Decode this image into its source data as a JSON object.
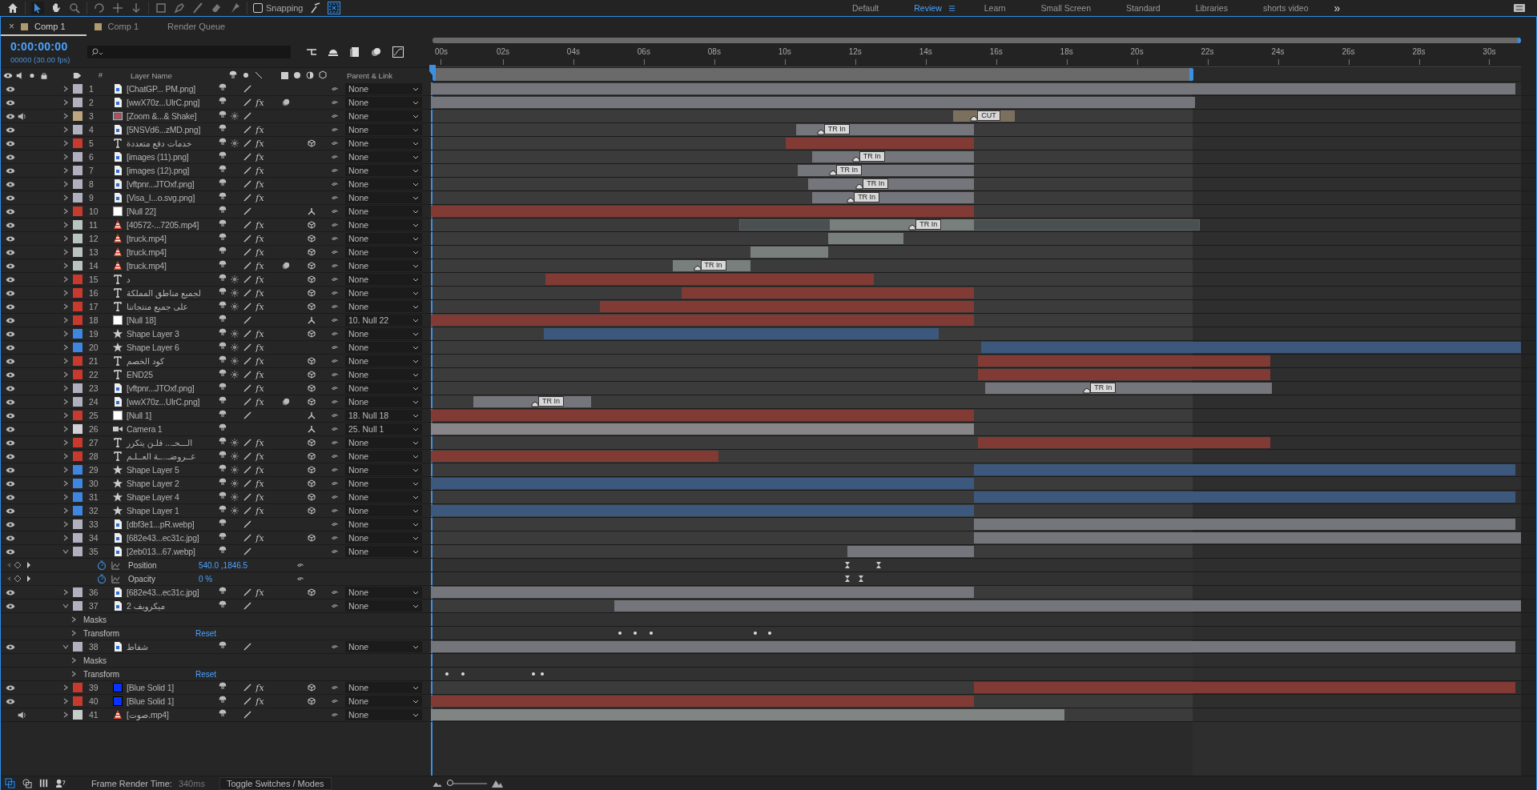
{
  "toolbar": {
    "snapping": {
      "label": "Snapping",
      "checked": false
    },
    "workspaces": [
      {
        "label": "Default",
        "selected": false
      },
      {
        "label": "Review",
        "selected": true
      },
      {
        "label": "Learn",
        "selected": false
      },
      {
        "label": "Small Screen",
        "selected": false
      },
      {
        "label": "Standard",
        "selected": false
      },
      {
        "label": "Libraries",
        "selected": false
      },
      {
        "label": "shorts video",
        "selected": false
      }
    ],
    "more": "»"
  },
  "tabs": [
    {
      "label": "Comp 1",
      "selected": true,
      "close": "×"
    },
    {
      "label": "Comp 1",
      "selected": false
    },
    {
      "label": "Render Queue",
      "selected": false
    }
  ],
  "timecode": "0:00:00:00",
  "frame_info": "00000 (30.00 fps)",
  "columns": {
    "number": "#",
    "layer_name": "Layer Name",
    "parent": "Parent & Link"
  },
  "ruler": {
    "ticks": [
      "00s",
      "02s",
      "04s",
      "06s",
      "08s",
      "10s",
      "12s",
      "14s",
      "16s",
      "18s",
      "20s",
      "22s",
      "24s",
      "26s",
      "28s",
      "30s"
    ]
  },
  "layers": [
    {
      "n": "1",
      "name": "[ChatGP... PM.png]",
      "kind": "image",
      "color": "#b0b0be",
      "video": true,
      "audio": false,
      "fx": false,
      "motion_blur": false,
      "three_d": false,
      "expanded": false,
      "parent": "None"
    },
    {
      "n": "2",
      "name": "[wwX70z...UlrC.png]",
      "kind": "image",
      "color": "#b0b0be",
      "video": true,
      "audio": false,
      "fx": true,
      "fx_label": "fx",
      "motion_blur": true,
      "three_d": false,
      "expanded": false,
      "parent": "None"
    },
    {
      "n": "3",
      "name": "[Zoom &...& Shake]",
      "kind": "precomp",
      "color": "#bca681",
      "video": true,
      "audio": true,
      "fx": false,
      "motion_blur": false,
      "three_d": false,
      "expanded": false,
      "parent": "None",
      "markers": [
        {
          "label": "CUT"
        }
      ]
    },
    {
      "n": "4",
      "name": "[5NSVd6...zMD.png]",
      "kind": "image",
      "color": "#b0b0be",
      "video": true,
      "audio": false,
      "fx": true,
      "fx_label": "fx",
      "motion_blur": false,
      "three_d": false,
      "expanded": false,
      "parent": "None",
      "markers": [
        {
          "label": "TR In"
        }
      ]
    },
    {
      "n": "5",
      "name": "خدمات دفع متعددة",
      "kind": "text",
      "color": "#c8392e",
      "video": true,
      "audio": false,
      "fx": true,
      "fx_label": "fx",
      "motion_blur": false,
      "three_d": true,
      "expanded": false,
      "parent": "None"
    },
    {
      "n": "6",
      "name": "[images (11).png]",
      "kind": "image",
      "color": "#b0b0be",
      "video": true,
      "audio": false,
      "fx": true,
      "fx_label": "fx",
      "motion_blur": false,
      "three_d": false,
      "expanded": false,
      "parent": "None",
      "markers": [
        {
          "label": "TR In"
        }
      ]
    },
    {
      "n": "7",
      "name": "[images (12).png]",
      "kind": "image",
      "color": "#b0b0be",
      "video": true,
      "audio": false,
      "fx": true,
      "fx_label": "fx",
      "motion_blur": false,
      "three_d": false,
      "expanded": false,
      "parent": "None",
      "markers": [
        {
          "label": "TR In"
        }
      ]
    },
    {
      "n": "8",
      "name": "[vftpnr...JTOxf.png]",
      "kind": "image",
      "color": "#b0b0be",
      "video": true,
      "audio": false,
      "fx": true,
      "fx_label": "fx",
      "motion_blur": false,
      "three_d": false,
      "expanded": false,
      "parent": "None",
      "markers": [
        {
          "label": "TR In"
        }
      ]
    },
    {
      "n": "9",
      "name": "[Visa_I...o.svg.png]",
      "kind": "image",
      "color": "#b0b0be",
      "video": true,
      "audio": false,
      "fx": true,
      "fx_label": "fx",
      "motion_blur": false,
      "three_d": false,
      "expanded": false,
      "parent": "None",
      "markers": [
        {
          "label": "TR In"
        }
      ]
    },
    {
      "n": "10",
      "name": "[Null 22]",
      "kind": "null",
      "color": "#c8392e",
      "video": true,
      "audio": false,
      "fx": false,
      "motion_blur": false,
      "three_d": false,
      "expanded": false,
      "parent": "None"
    },
    {
      "n": "11",
      "name": "[40572-...7205.mp4]",
      "kind": "video",
      "color": "#b8c4c0",
      "video": true,
      "audio": false,
      "fx": true,
      "fx_label": "fx",
      "motion_blur": false,
      "three_d": true,
      "expanded": false,
      "parent": "None",
      "markers": [
        {
          "label": "TR In"
        }
      ]
    },
    {
      "n": "12",
      "name": "[truck.mp4]",
      "kind": "video",
      "color": "#b8c4c0",
      "video": true,
      "audio": false,
      "fx": true,
      "fx_label": "fx",
      "motion_blur": false,
      "three_d": true,
      "expanded": false,
      "parent": "None"
    },
    {
      "n": "13",
      "name": "[truck.mp4]",
      "kind": "video",
      "color": "#b8c4c0",
      "video": true,
      "audio": false,
      "fx": true,
      "fx_label": "fx",
      "motion_blur": false,
      "three_d": true,
      "expanded": false,
      "parent": "None"
    },
    {
      "n": "14",
      "name": "[truck.mp4]",
      "kind": "video",
      "color": "#b8c4c0",
      "video": true,
      "audio": false,
      "fx": true,
      "fx_label": "fx",
      "motion_blur": true,
      "three_d": true,
      "expanded": false,
      "parent": "None",
      "markers": [
        {
          "label": "TR In"
        }
      ]
    },
    {
      "n": "15",
      "name": "د",
      "kind": "text",
      "color": "#c8392e",
      "video": true,
      "audio": false,
      "fx": true,
      "fx_label": "fx",
      "motion_blur": false,
      "three_d": true,
      "expanded": false,
      "parent": "None"
    },
    {
      "n": "16",
      "name": "لجميع مناطق المملكة",
      "kind": "text",
      "color": "#c8392e",
      "video": true,
      "audio": false,
      "fx": true,
      "fx_label": "fx",
      "motion_blur": false,
      "three_d": true,
      "expanded": false,
      "parent": "None"
    },
    {
      "n": "17",
      "name": "على جميع منتجاتنا",
      "kind": "text",
      "color": "#c8392e",
      "video": true,
      "audio": false,
      "fx": true,
      "fx_label": "fx",
      "motion_blur": false,
      "three_d": true,
      "expanded": false,
      "parent": "None"
    },
    {
      "n": "18",
      "name": "[Null 18]",
      "kind": "null",
      "color": "#c8392e",
      "video": true,
      "audio": false,
      "fx": false,
      "motion_blur": false,
      "three_d": false,
      "expanded": false,
      "parent": "10. Null 22"
    },
    {
      "n": "19",
      "name": "Shape Layer 3",
      "kind": "shape",
      "color": "#3e86e0",
      "video": true,
      "audio": false,
      "fx": true,
      "fx_label": "fx",
      "motion_blur": false,
      "three_d": true,
      "expanded": false,
      "parent": "None"
    },
    {
      "n": "20",
      "name": "Shape Layer 6",
      "kind": "shape",
      "color": "#3e86e0",
      "video": true,
      "audio": false,
      "fx": true,
      "fx_label": "fx",
      "motion_blur": false,
      "three_d": false,
      "expanded": false,
      "parent": "None"
    },
    {
      "n": "21",
      "name": "كود الخصم",
      "kind": "text",
      "color": "#c8392e",
      "video": true,
      "audio": false,
      "fx": true,
      "fx_label": "fx",
      "motion_blur": false,
      "three_d": true,
      "expanded": false,
      "parent": "None"
    },
    {
      "n": "22",
      "name": "END25",
      "kind": "text",
      "color": "#c8392e",
      "video": true,
      "audio": false,
      "fx": true,
      "fx_label": "fx",
      "motion_blur": false,
      "three_d": true,
      "expanded": false,
      "parent": "None"
    },
    {
      "n": "23",
      "name": "[vftpnr...JTOxf.png]",
      "kind": "image",
      "color": "#b0b0be",
      "video": true,
      "audio": false,
      "fx": true,
      "fx_label": "fx",
      "motion_blur": false,
      "three_d": true,
      "expanded": false,
      "parent": "None",
      "markers": [
        {
          "label": "TR In"
        }
      ]
    },
    {
      "n": "24",
      "name": "[wwX70z...UlrC.png]",
      "kind": "image",
      "color": "#b0b0be",
      "video": true,
      "audio": false,
      "fx": true,
      "fx_label": "fx",
      "motion_blur": true,
      "three_d": true,
      "expanded": false,
      "parent": "None",
      "markers": [
        {
          "label": "TR In"
        }
      ]
    },
    {
      "n": "25",
      "name": "[Null 1]",
      "kind": "null",
      "color": "#c8392e",
      "video": true,
      "audio": false,
      "fx": false,
      "motion_blur": false,
      "three_d": false,
      "expanded": false,
      "parent": "18. Null 18"
    },
    {
      "n": "26",
      "name": "Camera 1",
      "kind": "camera",
      "color": "#d4d0d4",
      "video": true,
      "audio": false,
      "fx": false,
      "motion_blur": false,
      "three_d": false,
      "expanded": false,
      "parent": "25. Null 1"
    },
    {
      "n": "27",
      "name": "الـــحـ... فلـن يتكرر",
      "kind": "text",
      "color": "#c8392e",
      "video": true,
      "audio": false,
      "fx": true,
      "fx_label": "fx",
      "motion_blur": false,
      "three_d": true,
      "expanded": false,
      "parent": "None"
    },
    {
      "n": "28",
      "name": "عــروضـ...ـة العــلـم",
      "kind": "text",
      "color": "#c8392e",
      "video": true,
      "audio": false,
      "fx": true,
      "fx_label": "fx",
      "motion_blur": false,
      "three_d": true,
      "expanded": false,
      "parent": "None"
    },
    {
      "n": "29",
      "name": "Shape Layer 5",
      "kind": "shape",
      "color": "#3e86e0",
      "video": true,
      "audio": false,
      "fx": true,
      "fx_label": "fx",
      "motion_blur": false,
      "three_d": true,
      "expanded": false,
      "parent": "None"
    },
    {
      "n": "30",
      "name": "Shape Layer 2",
      "kind": "shape",
      "color": "#3e86e0",
      "video": true,
      "audio": false,
      "fx": true,
      "fx_label": "fx",
      "motion_blur": false,
      "three_d": true,
      "expanded": false,
      "parent": "None"
    },
    {
      "n": "31",
      "name": "Shape Layer 4",
      "kind": "shape",
      "color": "#3e86e0",
      "video": true,
      "audio": false,
      "fx": true,
      "fx_label": "fx",
      "motion_blur": false,
      "three_d": true,
      "expanded": false,
      "parent": "None"
    },
    {
      "n": "32",
      "name": "Shape Layer 1",
      "kind": "shape",
      "color": "#3e86e0",
      "video": true,
      "audio": false,
      "fx": true,
      "fx_label": "fx",
      "motion_blur": false,
      "three_d": true,
      "expanded": false,
      "parent": "None"
    },
    {
      "n": "33",
      "name": "[dbf3e1...pR.webp]",
      "kind": "image",
      "color": "#b0b0be",
      "video": true,
      "audio": false,
      "fx": false,
      "motion_blur": false,
      "three_d": false,
      "expanded": false,
      "parent": "None"
    },
    {
      "n": "34",
      "name": "[682e43...ec31c.jpg]",
      "kind": "image",
      "color": "#b0b0be",
      "video": true,
      "audio": false,
      "fx": true,
      "fx_label": "fx",
      "motion_blur": false,
      "three_d": true,
      "expanded": false,
      "parent": "None"
    },
    {
      "n": "35",
      "name": "[2eb013...67.webp]",
      "kind": "image",
      "color": "#b0b0be",
      "video": true,
      "audio": false,
      "fx": false,
      "motion_blur": false,
      "three_d": false,
      "expanded": true,
      "parent": "None",
      "properties": [
        {
          "kind": "stopwatch",
          "name": "Position",
          "value": "540.0 ,1846.5"
        },
        {
          "kind": "stopwatch",
          "name": "Opacity",
          "value": "0 %"
        }
      ]
    },
    {
      "n": "36",
      "name": "[682e43...ec31c.jpg]",
      "kind": "image",
      "color": "#b0b0be",
      "video": true,
      "audio": false,
      "fx": true,
      "fx_label": "fx",
      "motion_blur": false,
      "three_d": true,
      "expanded": false,
      "parent": "None"
    },
    {
      "n": "37",
      "name": "ميكرويف 2",
      "kind": "image",
      "color": "#b0b0be",
      "video": true,
      "audio": false,
      "fx": false,
      "motion_blur": false,
      "three_d": false,
      "expanded": true,
      "parent": "None",
      "properties": [
        {
          "kind": "group",
          "name": "Masks"
        },
        {
          "kind": "group",
          "name": "Transform",
          "value": "Reset"
        }
      ]
    },
    {
      "n": "38",
      "name": "شفاط",
      "kind": "image",
      "color": "#b0b0be",
      "video": true,
      "audio": false,
      "fx": false,
      "motion_blur": false,
      "three_d": false,
      "expanded": true,
      "parent": "None",
      "properties": [
        {
          "kind": "group",
          "name": "Masks"
        },
        {
          "kind": "group",
          "name": "Transform",
          "value": "Reset"
        }
      ]
    },
    {
      "n": "39",
      "name": "[Blue Solid 1]",
      "kind": "solid",
      "color": "#c8392e",
      "video": true,
      "audio": false,
      "fx": true,
      "fx_label": "fx",
      "motion_blur": false,
      "three_d": true,
      "expanded": false,
      "parent": "None"
    },
    {
      "n": "40",
      "name": "[Blue Solid 1]",
      "kind": "solid",
      "color": "#c8392e",
      "video": true,
      "audio": false,
      "fx": true,
      "fx_label": "fx",
      "motion_blur": false,
      "three_d": true,
      "expanded": false,
      "parent": "None"
    },
    {
      "n": "41",
      "name": "[صوت.mp4]",
      "kind": "video",
      "color": "#c6cdc9",
      "video": false,
      "audio": true,
      "fx": false,
      "motion_blur": false,
      "three_d": false,
      "expanded": false,
      "parent": "None"
    }
  ],
  "status": {
    "label": "Frame Render Time:",
    "value": "340ms",
    "toggle": "Toggle Switches / Modes",
    "zoom": {
      "level": 0.08
    }
  }
}
